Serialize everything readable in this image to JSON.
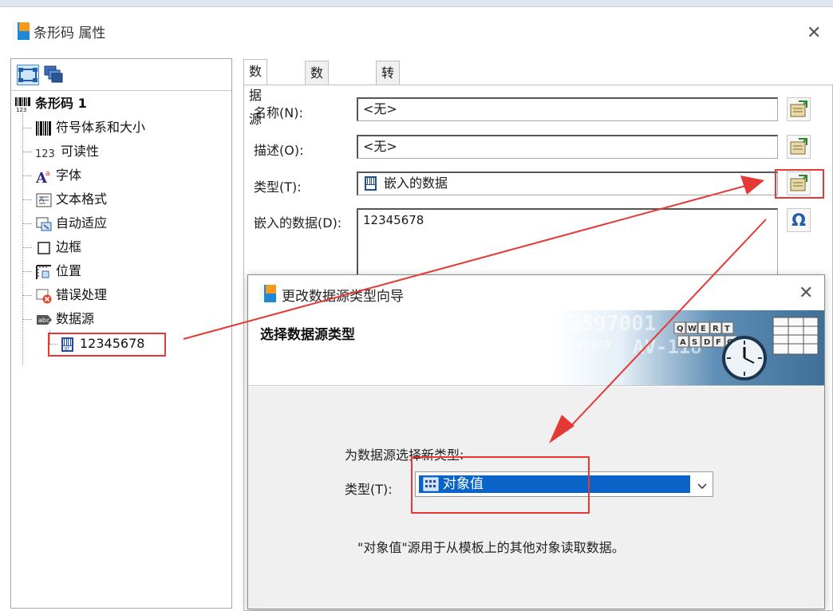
{
  "window": {
    "title": "条形码 属性",
    "close_glyph": "✕"
  },
  "tree": {
    "root_label": "条形码 1",
    "items": [
      {
        "label": "符号体系和大小",
        "icon": "barcode-icon"
      },
      {
        "label": "可读性",
        "prefix": "123",
        "icon": "readability-icon"
      },
      {
        "label": "字体",
        "icon": "font-icon"
      },
      {
        "label": "文本格式",
        "icon": "text-format-icon"
      },
      {
        "label": "自动适应",
        "icon": "auto-fit-icon"
      },
      {
        "label": "边框",
        "icon": "border-icon"
      },
      {
        "label": "位置",
        "icon": "position-icon"
      },
      {
        "label": "错误处理",
        "icon": "error-handling-icon"
      },
      {
        "label": "数据源",
        "icon": "datasource-icon"
      }
    ],
    "child_label": "12345678",
    "root_prefix": "123"
  },
  "tabs": [
    "数据源",
    "数据类型",
    "转换"
  ],
  "form": {
    "name_label": "名称(N):",
    "name_value": "<无>",
    "desc_label": "描述(O):",
    "desc_value": "<无>",
    "type_label": "类型(T):",
    "type_value": "嵌入的数据",
    "embedded_label": "嵌入的数据(D):",
    "embedded_value": "12345678",
    "omega_glyph": "Ω"
  },
  "wizard": {
    "title": "更改数据源类型向导",
    "close_glyph": "✕",
    "heading": "选择数据源类型",
    "banner_text_1": "3597001",
    "banner_text_2": "AV-118",
    "banner_text_3": "V2000",
    "keys_row_1": [
      "Q",
      "W",
      "E",
      "R",
      "T"
    ],
    "keys_row_2": [
      "A",
      "S",
      "D",
      "F",
      "G"
    ],
    "prompt": "为数据源选择新类型:",
    "type_label": "类型(T):",
    "type_value": "对象值",
    "description": "\"对象值\"源用于从模板上的其他对象读取数据。"
  },
  "colors": {
    "annotation_red": "#e53935",
    "selection_blue": "#0a64c8",
    "logo_blue": "#1e88d6",
    "logo_orange": "#f39a1f"
  }
}
